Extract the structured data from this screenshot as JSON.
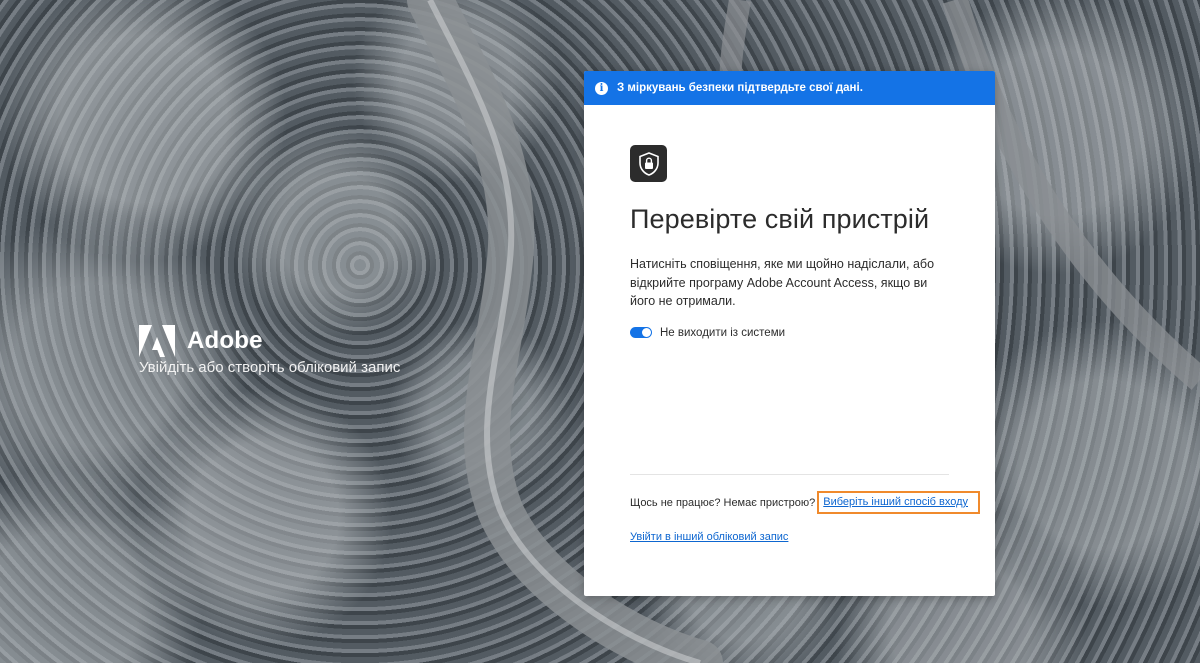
{
  "brand": {
    "name": "Adobe",
    "tagline": "Увійдіть або створіть обліковий запис"
  },
  "banner": {
    "icon": "info-icon",
    "text": "З міркувань безпеки підтвердьте свої дані."
  },
  "card": {
    "icon": "shield-lock-icon",
    "title": "Перевірте свій пристрій",
    "description": "Натисніть сповіщення, яке ми щойно надіслали, або відкрийте програму Adobe Account Access, якщо ви його не отримали.",
    "stay_signed_in": {
      "label": "Не виходити із системи",
      "checked": true
    },
    "help_text": "Щось не працює? Немає пристрою?",
    "other_method_link": "Виберіть інший спосіб входу",
    "other_account_link": "Увійти в інший обліковий запис"
  },
  "colors": {
    "accent": "#1473e6",
    "link": "#0d66d0",
    "highlight": "#f08a2c"
  }
}
